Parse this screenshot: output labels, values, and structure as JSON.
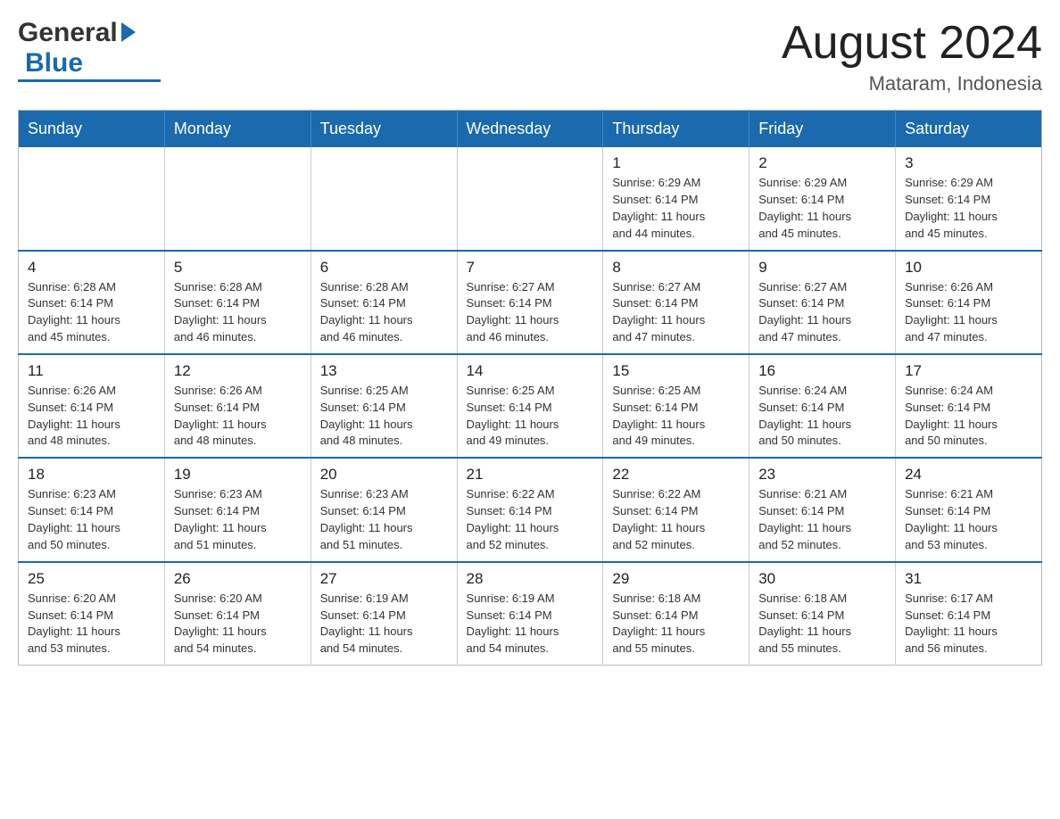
{
  "header": {
    "title": "August 2024",
    "subtitle": "Mataram, Indonesia",
    "logo_general": "General",
    "logo_blue": "Blue"
  },
  "days_of_week": [
    "Sunday",
    "Monday",
    "Tuesday",
    "Wednesday",
    "Thursday",
    "Friday",
    "Saturday"
  ],
  "weeks": [
    [
      {
        "day": "",
        "info": ""
      },
      {
        "day": "",
        "info": ""
      },
      {
        "day": "",
        "info": ""
      },
      {
        "day": "",
        "info": ""
      },
      {
        "day": "1",
        "info": "Sunrise: 6:29 AM\nSunset: 6:14 PM\nDaylight: 11 hours\nand 44 minutes."
      },
      {
        "day": "2",
        "info": "Sunrise: 6:29 AM\nSunset: 6:14 PM\nDaylight: 11 hours\nand 45 minutes."
      },
      {
        "day": "3",
        "info": "Sunrise: 6:29 AM\nSunset: 6:14 PM\nDaylight: 11 hours\nand 45 minutes."
      }
    ],
    [
      {
        "day": "4",
        "info": "Sunrise: 6:28 AM\nSunset: 6:14 PM\nDaylight: 11 hours\nand 45 minutes."
      },
      {
        "day": "5",
        "info": "Sunrise: 6:28 AM\nSunset: 6:14 PM\nDaylight: 11 hours\nand 46 minutes."
      },
      {
        "day": "6",
        "info": "Sunrise: 6:28 AM\nSunset: 6:14 PM\nDaylight: 11 hours\nand 46 minutes."
      },
      {
        "day": "7",
        "info": "Sunrise: 6:27 AM\nSunset: 6:14 PM\nDaylight: 11 hours\nand 46 minutes."
      },
      {
        "day": "8",
        "info": "Sunrise: 6:27 AM\nSunset: 6:14 PM\nDaylight: 11 hours\nand 47 minutes."
      },
      {
        "day": "9",
        "info": "Sunrise: 6:27 AM\nSunset: 6:14 PM\nDaylight: 11 hours\nand 47 minutes."
      },
      {
        "day": "10",
        "info": "Sunrise: 6:26 AM\nSunset: 6:14 PM\nDaylight: 11 hours\nand 47 minutes."
      }
    ],
    [
      {
        "day": "11",
        "info": "Sunrise: 6:26 AM\nSunset: 6:14 PM\nDaylight: 11 hours\nand 48 minutes."
      },
      {
        "day": "12",
        "info": "Sunrise: 6:26 AM\nSunset: 6:14 PM\nDaylight: 11 hours\nand 48 minutes."
      },
      {
        "day": "13",
        "info": "Sunrise: 6:25 AM\nSunset: 6:14 PM\nDaylight: 11 hours\nand 48 minutes."
      },
      {
        "day": "14",
        "info": "Sunrise: 6:25 AM\nSunset: 6:14 PM\nDaylight: 11 hours\nand 49 minutes."
      },
      {
        "day": "15",
        "info": "Sunrise: 6:25 AM\nSunset: 6:14 PM\nDaylight: 11 hours\nand 49 minutes."
      },
      {
        "day": "16",
        "info": "Sunrise: 6:24 AM\nSunset: 6:14 PM\nDaylight: 11 hours\nand 50 minutes."
      },
      {
        "day": "17",
        "info": "Sunrise: 6:24 AM\nSunset: 6:14 PM\nDaylight: 11 hours\nand 50 minutes."
      }
    ],
    [
      {
        "day": "18",
        "info": "Sunrise: 6:23 AM\nSunset: 6:14 PM\nDaylight: 11 hours\nand 50 minutes."
      },
      {
        "day": "19",
        "info": "Sunrise: 6:23 AM\nSunset: 6:14 PM\nDaylight: 11 hours\nand 51 minutes."
      },
      {
        "day": "20",
        "info": "Sunrise: 6:23 AM\nSunset: 6:14 PM\nDaylight: 11 hours\nand 51 minutes."
      },
      {
        "day": "21",
        "info": "Sunrise: 6:22 AM\nSunset: 6:14 PM\nDaylight: 11 hours\nand 52 minutes."
      },
      {
        "day": "22",
        "info": "Sunrise: 6:22 AM\nSunset: 6:14 PM\nDaylight: 11 hours\nand 52 minutes."
      },
      {
        "day": "23",
        "info": "Sunrise: 6:21 AM\nSunset: 6:14 PM\nDaylight: 11 hours\nand 52 minutes."
      },
      {
        "day": "24",
        "info": "Sunrise: 6:21 AM\nSunset: 6:14 PM\nDaylight: 11 hours\nand 53 minutes."
      }
    ],
    [
      {
        "day": "25",
        "info": "Sunrise: 6:20 AM\nSunset: 6:14 PM\nDaylight: 11 hours\nand 53 minutes."
      },
      {
        "day": "26",
        "info": "Sunrise: 6:20 AM\nSunset: 6:14 PM\nDaylight: 11 hours\nand 54 minutes."
      },
      {
        "day": "27",
        "info": "Sunrise: 6:19 AM\nSunset: 6:14 PM\nDaylight: 11 hours\nand 54 minutes."
      },
      {
        "day": "28",
        "info": "Sunrise: 6:19 AM\nSunset: 6:14 PM\nDaylight: 11 hours\nand 54 minutes."
      },
      {
        "day": "29",
        "info": "Sunrise: 6:18 AM\nSunset: 6:14 PM\nDaylight: 11 hours\nand 55 minutes."
      },
      {
        "day": "30",
        "info": "Sunrise: 6:18 AM\nSunset: 6:14 PM\nDaylight: 11 hours\nand 55 minutes."
      },
      {
        "day": "31",
        "info": "Sunrise: 6:17 AM\nSunset: 6:14 PM\nDaylight: 11 hours\nand 56 minutes."
      }
    ]
  ]
}
